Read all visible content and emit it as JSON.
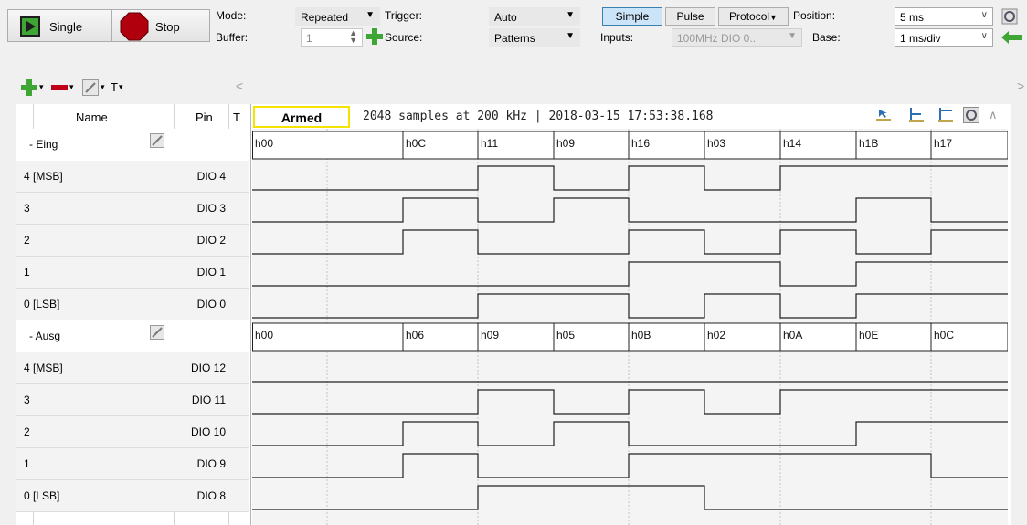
{
  "toolbar": {
    "single_label": "Single",
    "stop_label": "Stop",
    "mode_label": "Mode:",
    "mode_value": "Repeated",
    "buffer_label": "Buffer:",
    "buffer_value": "1",
    "trigger_label": "Trigger:",
    "trigger_value": "Auto",
    "source_label": "Source:",
    "source_value": "Patterns",
    "simple_label": "Simple",
    "pulse_label": "Pulse",
    "protocol_label": "Protocol",
    "inputs_label": "Inputs:",
    "inputs_value": "100MHz DIO 0..",
    "position_label": "Position:",
    "position_value": "5 ms",
    "base_label": "Base:",
    "base_value": "1 ms/div"
  },
  "columns": {
    "name": "Name",
    "pin": "Pin",
    "t": "T"
  },
  "status": {
    "state": "Armed",
    "info": "2048 samples at 200 kHz | 2018-03-15 17:53:38.168"
  },
  "groups": [
    {
      "name": "- Eing",
      "bus_values": [
        "h00",
        "h0C",
        "h11",
        "h09",
        "h16",
        "h03",
        "h14",
        "h1B",
        "h17"
      ],
      "signals": [
        {
          "name": "4 [MSB]",
          "pin": "DIO 4"
        },
        {
          "name": "3",
          "pin": "DIO 3"
        },
        {
          "name": "2",
          "pin": "DIO 2"
        },
        {
          "name": "1",
          "pin": "DIO 1"
        },
        {
          "name": "0 [LSB]",
          "pin": "DIO 0"
        }
      ]
    },
    {
      "name": "- Ausg",
      "bus_values": [
        "h00",
        "h06",
        "h09",
        "h05",
        "h0B",
        "h02",
        "h0A",
        "h0E",
        "h0C"
      ],
      "signals": [
        {
          "name": "4 [MSB]",
          "pin": "DIO 12"
        },
        {
          "name": "3",
          "pin": "DIO 11"
        },
        {
          "name": "2",
          "pin": "DIO 10"
        },
        {
          "name": "1",
          "pin": "DIO 9"
        },
        {
          "name": "0 [LSB]",
          "pin": "DIO 8"
        }
      ]
    }
  ],
  "colors": {
    "accent_green": "#3fa535",
    "stop_red": "#b0000d",
    "armed_border": "#f5e400",
    "wave": "#202020"
  },
  "icons": [
    "single-run-icon",
    "stop-icon",
    "add-icon",
    "remove-icon",
    "edit-icon",
    "text-icon",
    "settings-icon",
    "back-arrow-icon"
  ]
}
